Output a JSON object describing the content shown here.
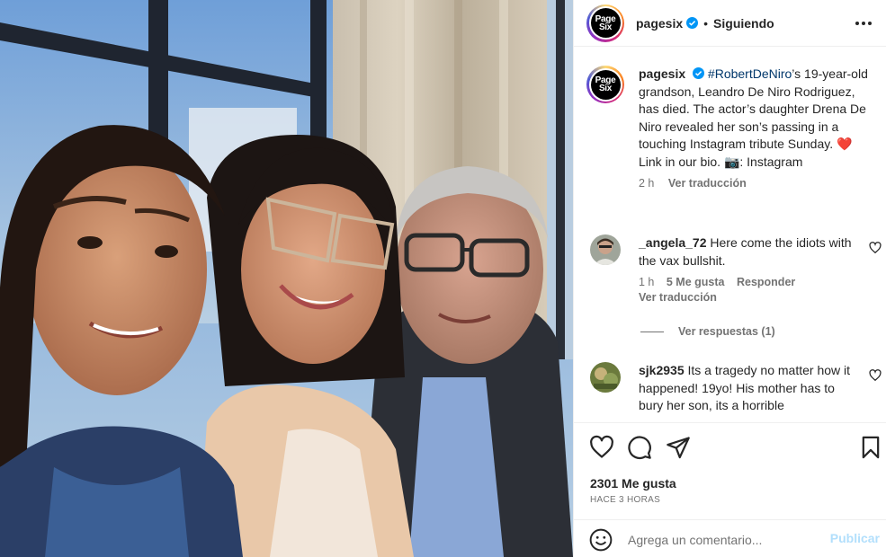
{
  "post": {
    "author": "pagesix",
    "logo_line1": "Page",
    "logo_line2": "Six",
    "follow_sep": "•",
    "follow_status": "Siguiendo"
  },
  "caption": {
    "author": "pagesix",
    "hashtag": "#RobertDeNiro",
    "text": "’s 19-year-old grandson, Leandro De Niro Rodriguez, has died. The actor’s daughter Drena De Niro revealed her son’s passing in a touching Instagram tribute Sunday. ❤️ Link in our bio. 📷: Instagram",
    "time": "2 h",
    "translate": "Ver traducción"
  },
  "comments": [
    {
      "author": "_angela_72",
      "text": "Here come the idiots with the vax bullshit.",
      "time": "1 h",
      "likes": "5 Me gusta",
      "reply": "Responder",
      "translate": "Ver traducción",
      "view_replies": "Ver respuestas (1)"
    },
    {
      "author": "sjk2935",
      "text": "Its a tragedy no matter how it happened! 19yo! His mother has to bury her son, its a horrible"
    }
  ],
  "footer": {
    "likes": "2301 Me gusta",
    "timestamp": "HACE 3 HORAS",
    "comment_placeholder": "Agrega un comentario...",
    "publish": "Publicar"
  },
  "icons": {
    "like": "heart-icon",
    "comment": "comment-icon",
    "share": "share-icon",
    "save": "bookmark-icon",
    "more": "more-options-icon",
    "verified": "verified-badge-icon",
    "emoji": "emoji-icon"
  },
  "colors": {
    "verified": "#0095f6",
    "hashtag": "#00376b",
    "publish_disabled": "#b2dffc",
    "muted": "#737373"
  }
}
